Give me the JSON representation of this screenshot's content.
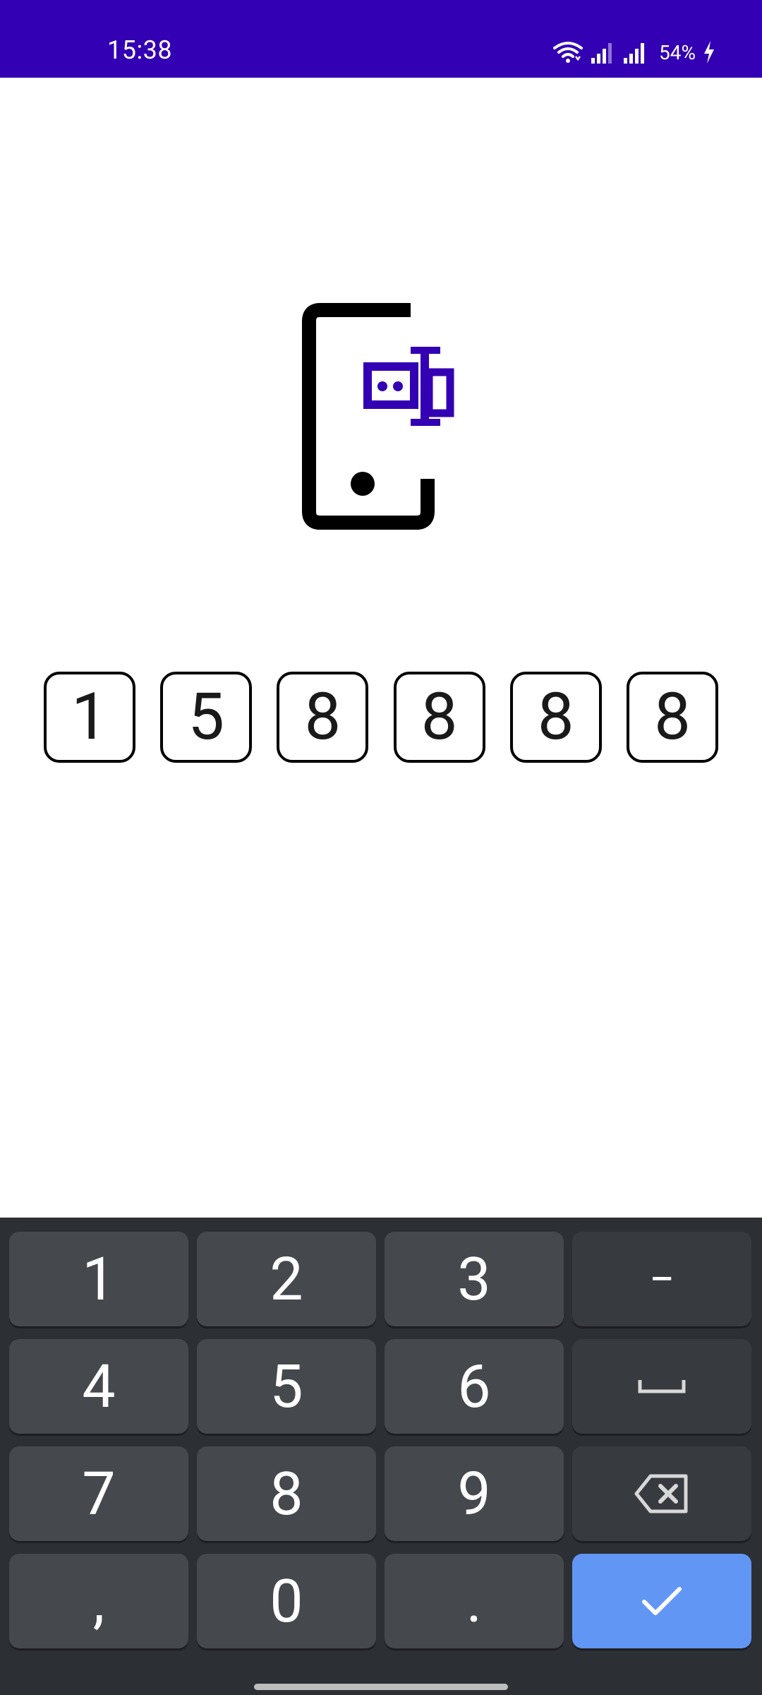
{
  "status_bar": {
    "time": "15:38",
    "battery": "54%",
    "icons": [
      "wifi-icon",
      "signal-icon",
      "signal-icon",
      "battery-charging-icon"
    ],
    "background": "#3300b3"
  },
  "illustration": {
    "icon": "phone-sms-code-icon",
    "accent": "#3300b3"
  },
  "otp": {
    "digits": [
      "1",
      "5",
      "8",
      "8",
      "8",
      "8"
    ]
  },
  "keyboard": {
    "keys": [
      {
        "label": "1"
      },
      {
        "label": "2"
      },
      {
        "label": "3"
      },
      {
        "label": "−"
      },
      {
        "label": "4"
      },
      {
        "label": "5"
      },
      {
        "label": "6"
      },
      {
        "label": "",
        "icon": "space-icon"
      },
      {
        "label": "7"
      },
      {
        "label": "8"
      },
      {
        "label": "9"
      },
      {
        "label": "",
        "icon": "backspace-icon"
      },
      {
        "label": ","
      },
      {
        "label": "0"
      },
      {
        "label": "."
      },
      {
        "label": "",
        "icon": "check-icon"
      }
    ],
    "enter_color": "#6196f4"
  }
}
